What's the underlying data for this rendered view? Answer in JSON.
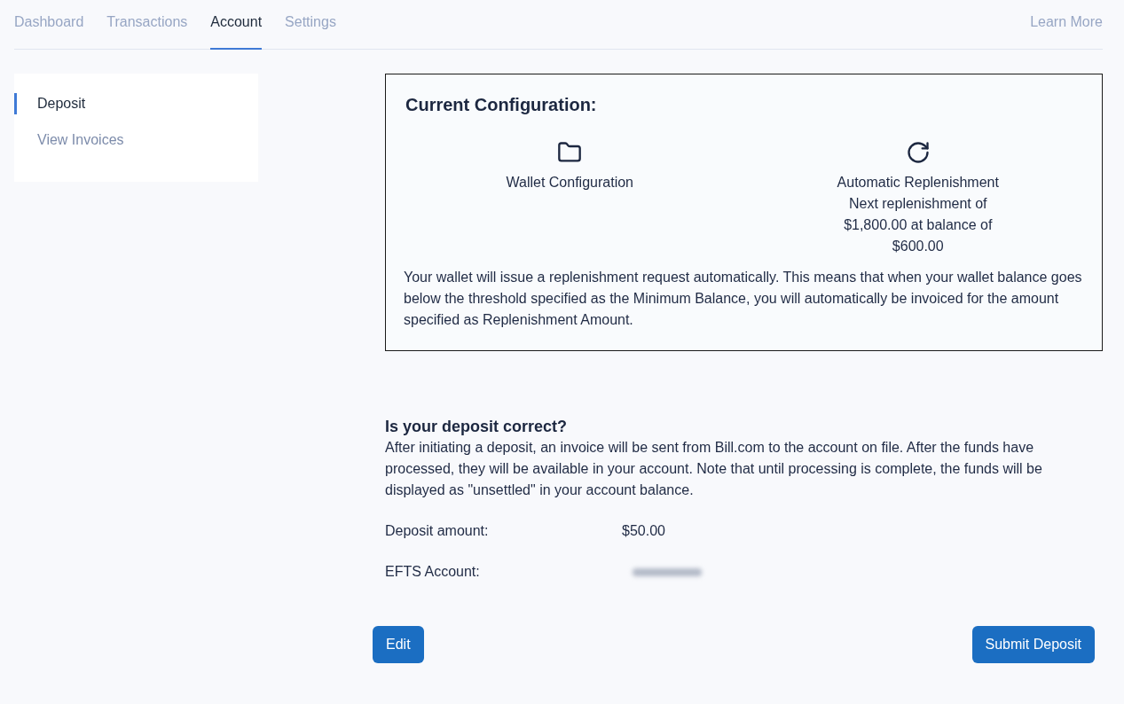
{
  "nav": {
    "tabs": [
      {
        "label": "Dashboard",
        "selected": false
      },
      {
        "label": "Transactions",
        "selected": false
      },
      {
        "label": "Account",
        "selected": true
      },
      {
        "label": "Settings",
        "selected": false
      }
    ],
    "link": "Learn More"
  },
  "sidebar": {
    "items": [
      {
        "label": "Deposit",
        "selected": true
      },
      {
        "label": "View Invoices",
        "selected": false
      }
    ]
  },
  "configuration": {
    "title": "Current Configuration:",
    "items": [
      {
        "title": "Wallet Configuration"
      },
      {
        "title": "Automatic Replenishment",
        "detail": "Next replenishment of $1,800.00 at balance of $600.00"
      }
    ],
    "description": "Your wallet will issue a replenishment request automatically. This means that when your wallet balance goes below the threshold specified as the Minimum Balance, you will automatically be invoiced for the amount specified as Replenishment Amount."
  },
  "deposit": {
    "title": "Is your deposit correct?",
    "description": "After initiating a deposit, an invoice will be sent from Bill.com to the account on file. After the funds have processed, they will be available in your account. Note that until processing is complete, the funds will be displayed as \"unsettled\" in your account balance.",
    "fields": [
      {
        "label": "Deposit amount:",
        "value": "$50.00",
        "redacted": false
      },
      {
        "label": "EFTS Account:",
        "redacted": true
      }
    ]
  },
  "buttons": [
    "Edit",
    "Submit Deposit"
  ]
}
